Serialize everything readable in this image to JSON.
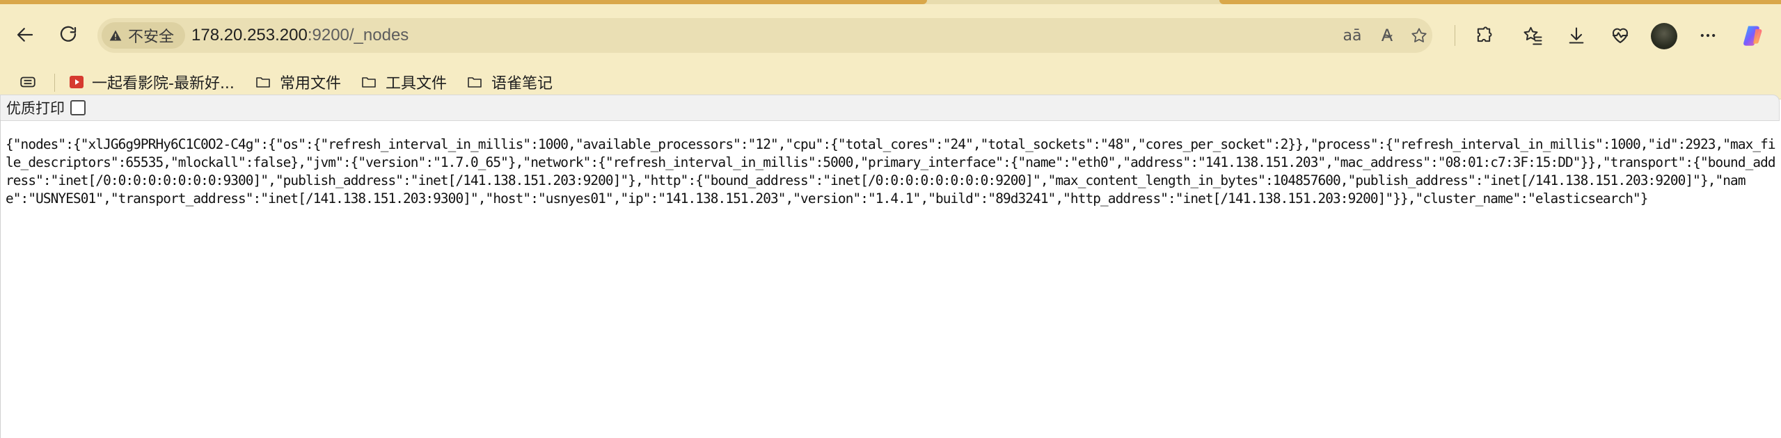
{
  "browser": {
    "security_label": "不安全",
    "url_host": "178.20.253.200",
    "url_path": ":9200/_nodes",
    "icons": {
      "back": "back-arrow-icon",
      "refresh": "refresh-icon",
      "warning": "warning-icon",
      "read_aloud_translate": "translate-icon",
      "read_aloud": "read-aloud-icon",
      "favorite": "star-icon",
      "extensions": "extensions-icon",
      "favorites": "favorites-icon",
      "downloads": "download-icon",
      "health": "heart-pulse-icon",
      "more": "more-icon",
      "copilot": "copilot-icon"
    }
  },
  "bookmarks": [
    {
      "label": "一起看影院-最新好...",
      "icon": "video-icon"
    },
    {
      "label": "常用文件",
      "icon": "folder-icon"
    },
    {
      "label": "工具文件",
      "icon": "folder-icon"
    },
    {
      "label": "语雀笔记",
      "icon": "folder-icon"
    }
  ],
  "printbar": {
    "label": "优质打印"
  },
  "content": {
    "json_text": "{\"nodes\":{\"xlJG6g9PRHy6C1C0O2-C4g\":{\"os\":{\"refresh_interval_in_millis\":1000,\"available_processors\":\"12\",\"cpu\":{\"total_cores\":\"24\",\"total_sockets\":\"48\",\"cores_per_socket\":2}},\"process\":{\"refresh_interval_in_millis\":1000,\"id\":2923,\"max_file_descriptors\":65535,\"mlockall\":false},\"jvm\":{\"version\":\"1.7.0_65\"},\"network\":{\"refresh_interval_in_millis\":5000,\"primary_interface\":{\"name\":\"eth0\",\"address\":\"141.138.151.203\",\"mac_address\":\"08:01:c7:3F:15:DD\"}},\"transport\":{\"bound_address\":\"inet[/0:0:0:0:0:0:0:0:9300]\",\"publish_address\":\"inet[/141.138.151.203:9200]\"},\"http\":{\"bound_address\":\"inet[/0:0:0:0:0:0:0:0:9200]\",\"max_content_length_in_bytes\":104857600,\"publish_address\":\"inet[/141.138.151.203:9200]\"},\"name\":\"USNYES01\",\"transport_address\":\"inet[/141.138.151.203:9300]\",\"host\":\"usnyes01\",\"ip\":\"141.138.151.203\",\"version\":\"1.4.1\",\"build\":\"89d3241\",\"http_address\":\"inet[/141.138.151.203:9200]\"}},\"cluster_name\":\"elasticsearch\"}"
  }
}
